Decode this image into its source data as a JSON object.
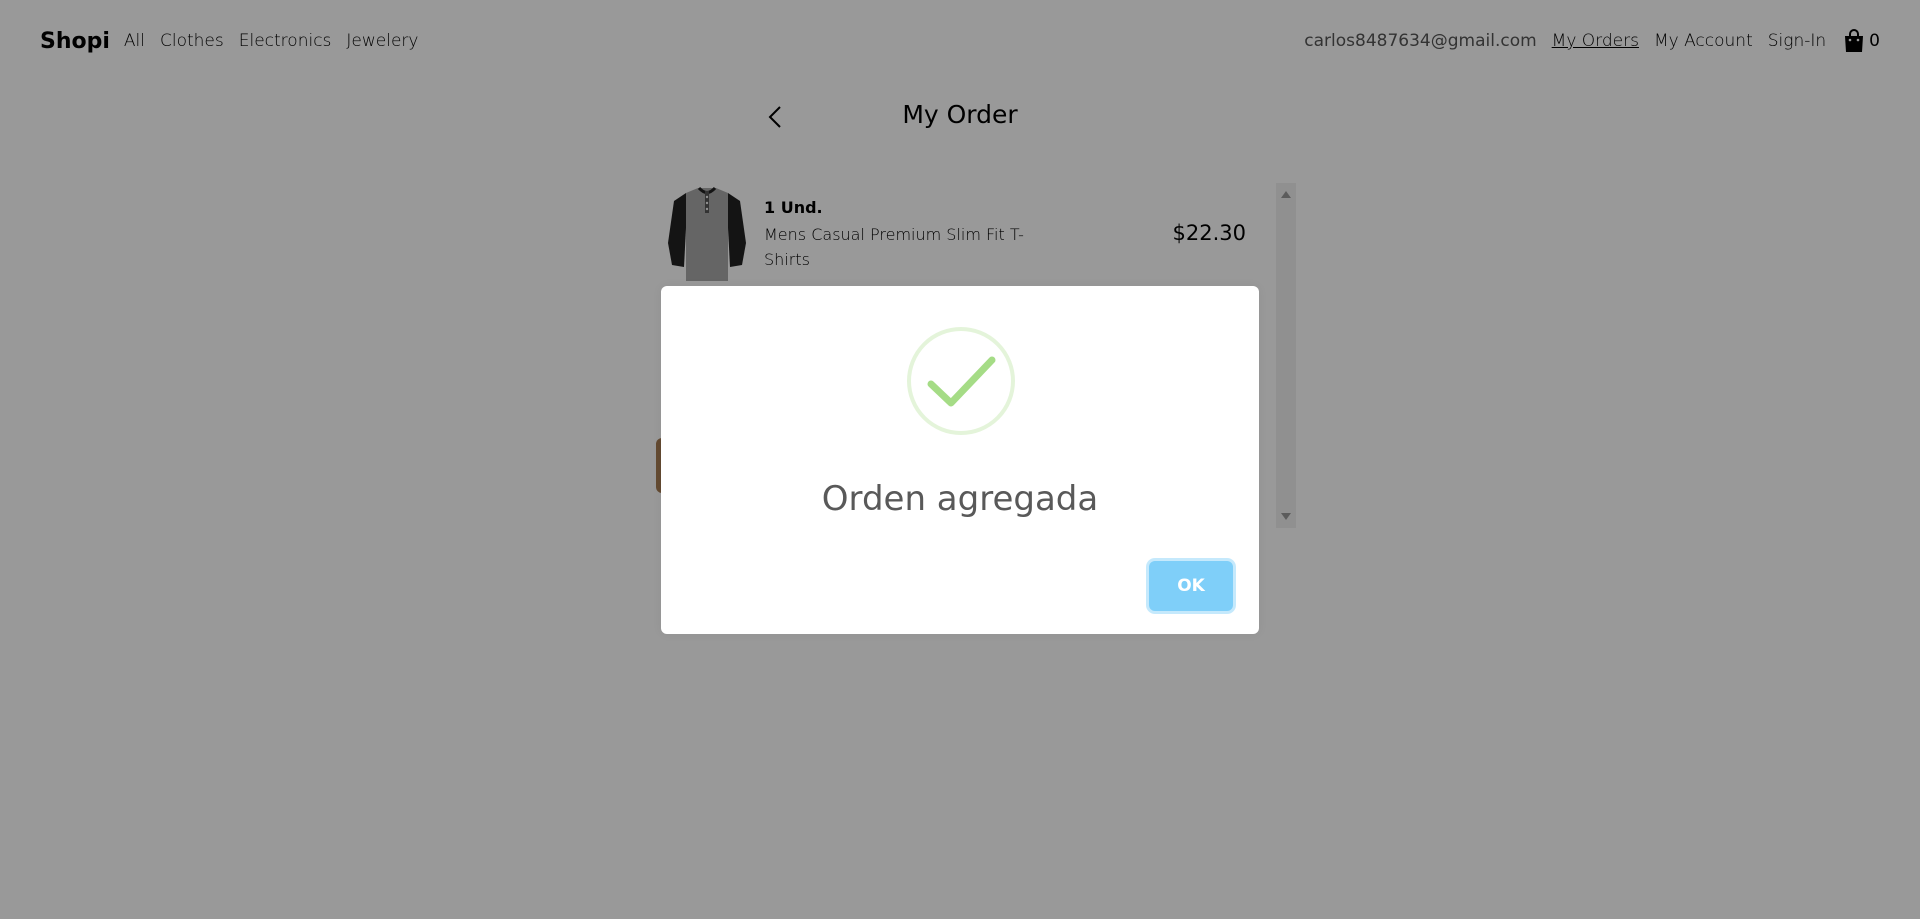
{
  "navbar": {
    "brand": "Shopi",
    "categories": [
      "All",
      "Clothes",
      "Electronics",
      "Jewelery"
    ],
    "email": "carlos8487634@gmail.com",
    "links": [
      "My Orders",
      "My Account",
      "Sign-In"
    ],
    "cart_count": "0"
  },
  "page": {
    "title": "My Order"
  },
  "order": {
    "items": [
      {
        "qty": "1 Und.",
        "name": "Mens Casual Premium Slim Fit T-Shirts",
        "price": "$22.30"
      }
    ]
  },
  "modal": {
    "title": "Orden agregada",
    "ok_label": "OK",
    "icon": "check-icon",
    "accent_color": "#a5dc86",
    "button_color": "#7fcff9"
  }
}
